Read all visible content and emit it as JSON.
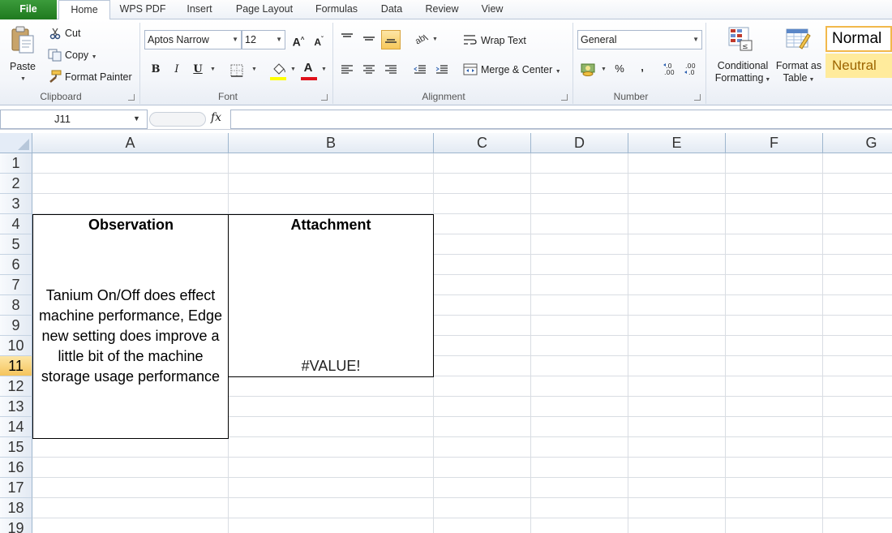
{
  "menu": {
    "tabs": [
      "File",
      "Home",
      "WPS PDF",
      "Insert",
      "Page Layout",
      "Formulas",
      "Data",
      "Review",
      "View"
    ],
    "active": "Home"
  },
  "ribbon": {
    "clipboard": {
      "paste": "Paste",
      "cut": "Cut",
      "copy": "Copy",
      "format_painter": "Format Painter",
      "label": "Clipboard"
    },
    "font": {
      "name": "Aptos Narrow",
      "size": "12",
      "grow": "A",
      "shrink": "A",
      "bold": "B",
      "italic": "I",
      "underline": "U",
      "font_color_letter": "A",
      "label": "Font",
      "highlight_color": "#ffff00",
      "font_color": "#e0101b"
    },
    "alignment": {
      "wrap_text": "Wrap Text",
      "merge_center": "Merge & Center",
      "label": "Alignment"
    },
    "number": {
      "format": "General",
      "percent": "%",
      "comma": ",",
      "label": "Number"
    },
    "styles": {
      "conditional_formatting_line1": "Conditional",
      "conditional_formatting_line2": "Formatting",
      "format_as_table_line1": "Format as",
      "format_as_table_line2": "Table",
      "normal": "Normal",
      "neutral": "Neutral",
      "neutral_bg": "#ffeb9c",
      "neutral_fg": "#9c6500"
    }
  },
  "formula_bar": {
    "name_box": "J11",
    "fx": "fx",
    "formula": ""
  },
  "sheet": {
    "columns": [
      "A",
      "B",
      "C",
      "D",
      "E",
      "F",
      "G"
    ],
    "rows": [
      "1",
      "2",
      "3",
      "4",
      "5",
      "6",
      "7",
      "8",
      "9",
      "10",
      "11",
      "12",
      "13",
      "14",
      "15",
      "16",
      "17",
      "18",
      "19"
    ],
    "selected_row": "11",
    "header_observation": "Observation",
    "header_attachment": "Attachment",
    "observation_text": "Tanium On/Off does effect machine performance, Edge new setting does improve a little bit of the machine storage usage performance",
    "attachment_values": [
      "",
      "",
      "",
      "",
      "",
      "",
      "#VALUE!"
    ]
  }
}
